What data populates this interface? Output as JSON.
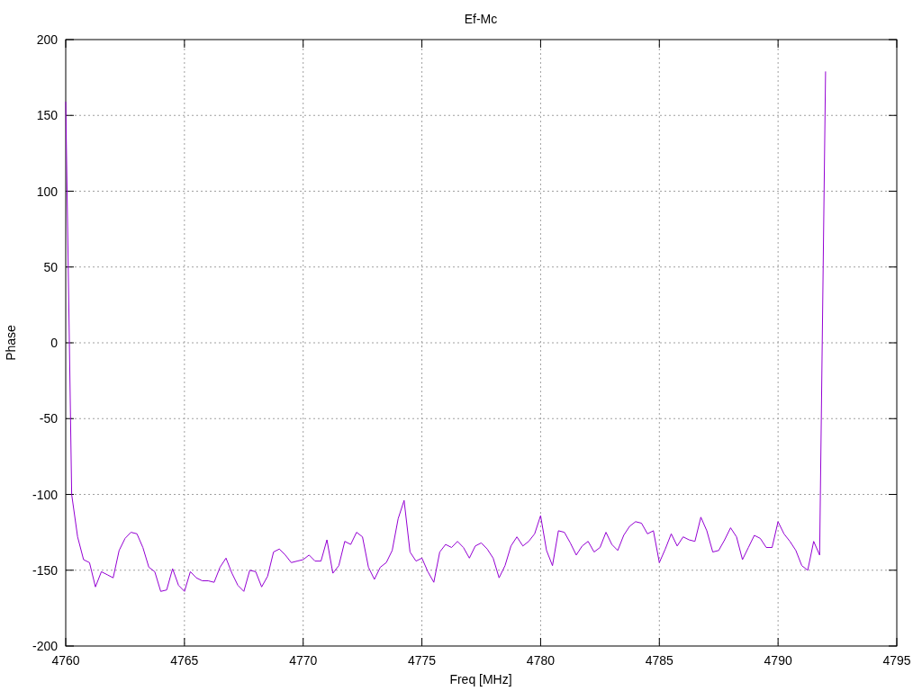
{
  "chart_data": {
    "type": "line",
    "title": "Ef-Mc",
    "xlabel": "Freq [MHz]",
    "ylabel": "Phase",
    "grid": true,
    "xlim": [
      4760,
      4795
    ],
    "ylim": [
      -200,
      200
    ],
    "xticks": [
      4760,
      4765,
      4770,
      4775,
      4780,
      4785,
      4790,
      4795
    ],
    "yticks": [
      -200,
      -150,
      -100,
      -50,
      0,
      50,
      100,
      150,
      200
    ],
    "x": [
      4760,
      4760.25,
      4760.5,
      4760.75,
      4761,
      4761.25,
      4761.5,
      4761.75,
      4762,
      4762.25,
      4762.5,
      4762.75,
      4763,
      4763.25,
      4763.5,
      4763.75,
      4764,
      4764.25,
      4764.5,
      4764.75,
      4765,
      4765.25,
      4765.5,
      4765.75,
      4766,
      4766.25,
      4766.5,
      4766.75,
      4767,
      4767.25,
      4767.5,
      4767.75,
      4768,
      4768.25,
      4768.5,
      4768.75,
      4769,
      4769.25,
      4769.5,
      4769.75,
      4770,
      4770.25,
      4770.5,
      4770.75,
      4771,
      4771.25,
      4771.5,
      4771.75,
      4772,
      4772.25,
      4772.5,
      4772.75,
      4773,
      4773.25,
      4773.5,
      4773.75,
      4774,
      4774.25,
      4774.5,
      4774.75,
      4775,
      4775.25,
      4775.5,
      4775.75,
      4776,
      4776.25,
      4776.5,
      4776.75,
      4777,
      4777.25,
      4777.5,
      4777.75,
      4778,
      4778.25,
      4778.5,
      4778.75,
      4779,
      4779.25,
      4779.5,
      4779.75,
      4780,
      4780.25,
      4780.5,
      4780.75,
      4781,
      4781.25,
      4781.5,
      4781.75,
      4782,
      4782.25,
      4782.5,
      4782.75,
      4783,
      4783.25,
      4783.5,
      4783.75,
      4784,
      4784.25,
      4784.5,
      4784.75,
      4785,
      4785.25,
      4785.5,
      4785.75,
      4786,
      4786.25,
      4786.5,
      4786.75,
      4787,
      4787.25,
      4787.5,
      4787.75,
      4788,
      4788.25,
      4788.5,
      4788.75,
      4789,
      4789.25,
      4789.5,
      4789.75,
      4790,
      4790.25,
      4790.5,
      4790.75,
      4791,
      4791.25,
      4791.5,
      4791.75,
      4792
    ],
    "series": [
      {
        "color": "#9400d3",
        "values": [
          159,
          -100,
          -128,
          -143,
          -145,
          -161,
          -151,
          -153,
          -155,
          -137,
          -129,
          -125,
          -126,
          -135,
          -148,
          -151,
          -164,
          -163,
          -149,
          -160,
          -164,
          -151,
          -155,
          -157,
          -157,
          -158,
          -148,
          -142,
          -152,
          -160,
          -164,
          -150,
          -151,
          -161,
          -154,
          -138,
          -136,
          -140,
          -145,
          -144,
          -143,
          -140,
          -144,
          -144,
          -130,
          -152,
          -147,
          -131,
          -133,
          -125,
          -128,
          -148,
          -156,
          -148,
          -145,
          -137,
          -116,
          -104,
          -138,
          -144,
          -142,
          -151,
          -158,
          -138,
          -133,
          -135,
          -131,
          -135,
          -142,
          -134,
          -132,
          -136,
          -142,
          -155,
          -147,
          -134,
          -128,
          -134,
          -131,
          -126,
          -114,
          -137,
          -147,
          -124,
          -125,
          -132,
          -140,
          -134,
          -131,
          -138,
          -135,
          -125,
          -133,
          -137,
          -127,
          -121,
          -118,
          -119,
          -126,
          -124,
          -145,
          -136,
          -126,
          -134,
          -128,
          -130,
          -131,
          -115,
          -124,
          -138,
          -137,
          -130,
          -122,
          -128,
          -143,
          -135,
          -127,
          -129,
          -135,
          -135,
          -118,
          -126,
          -131,
          -137,
          -147,
          -150,
          -131,
          -140,
          179
        ]
      }
    ]
  }
}
